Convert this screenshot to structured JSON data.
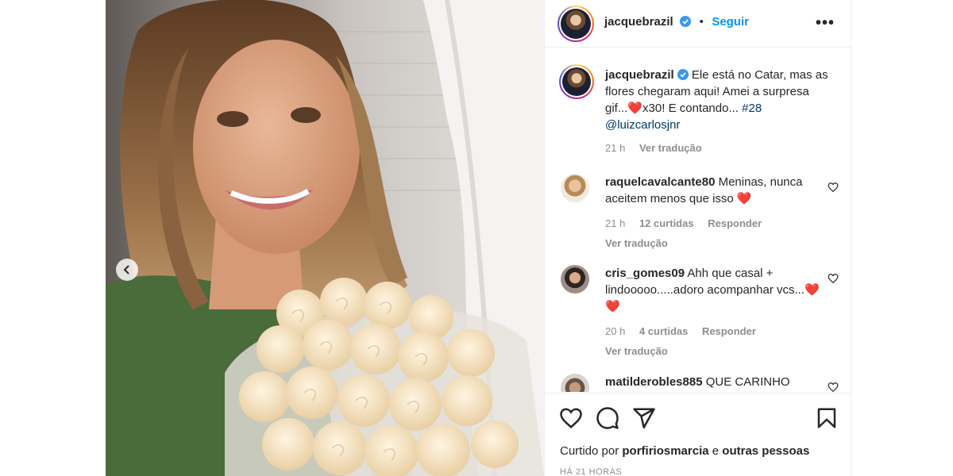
{
  "post": {
    "author": "jacquebrazil",
    "follow_label": "Seguir",
    "separator": "•",
    "more_label": "•••"
  },
  "caption": {
    "username": "jacquebrazil",
    "text_before_heart": "Ele está no Catar, mas as flores chegaram aqui! Amei a surpresa gif...",
    "heart": "❤️",
    "text_after_heart": "x30! E contando...",
    "hashtag": "#28",
    "mention": "@luizcarlosjnr",
    "time": "21 h",
    "translate": "Ver tradução"
  },
  "comments": [
    {
      "username": "raquelcavalcante80",
      "text": "Meninas, nunca aceitem menos que isso",
      "emoji": "❤️",
      "time": "21 h",
      "likes": "12 curtidas",
      "reply": "Responder",
      "translate": "Ver tradução"
    },
    {
      "username": "cris_gomes09",
      "text": "Ahh que casal + lindooooo.....adoro acompanhar vcs...",
      "emoji": "❤️❤️",
      "time": "20 h",
      "likes": "4 curtidas",
      "reply": "Responder",
      "translate": "Ver tradução"
    },
    {
      "username": "matilderobles885",
      "text": "QUE CARINHO"
    }
  ],
  "footer": {
    "liked_prefix": "Curtido por",
    "liked_user": "porfiriosmarcia",
    "liked_conj": "e",
    "liked_others": "outras pessoas",
    "time_ago": "HÁ 21 HORAS"
  },
  "icons": {
    "like": "heart-icon",
    "comment": "comment-icon",
    "share": "send-icon",
    "save": "bookmark-icon",
    "prev": "chevron-left-icon",
    "verified": "verified-badge-icon"
  },
  "colors": {
    "accent": "#0095f6",
    "verified": "#3897f0",
    "heart": "#ed4956",
    "muted": "#8e8e8e",
    "link": "#00376b"
  }
}
